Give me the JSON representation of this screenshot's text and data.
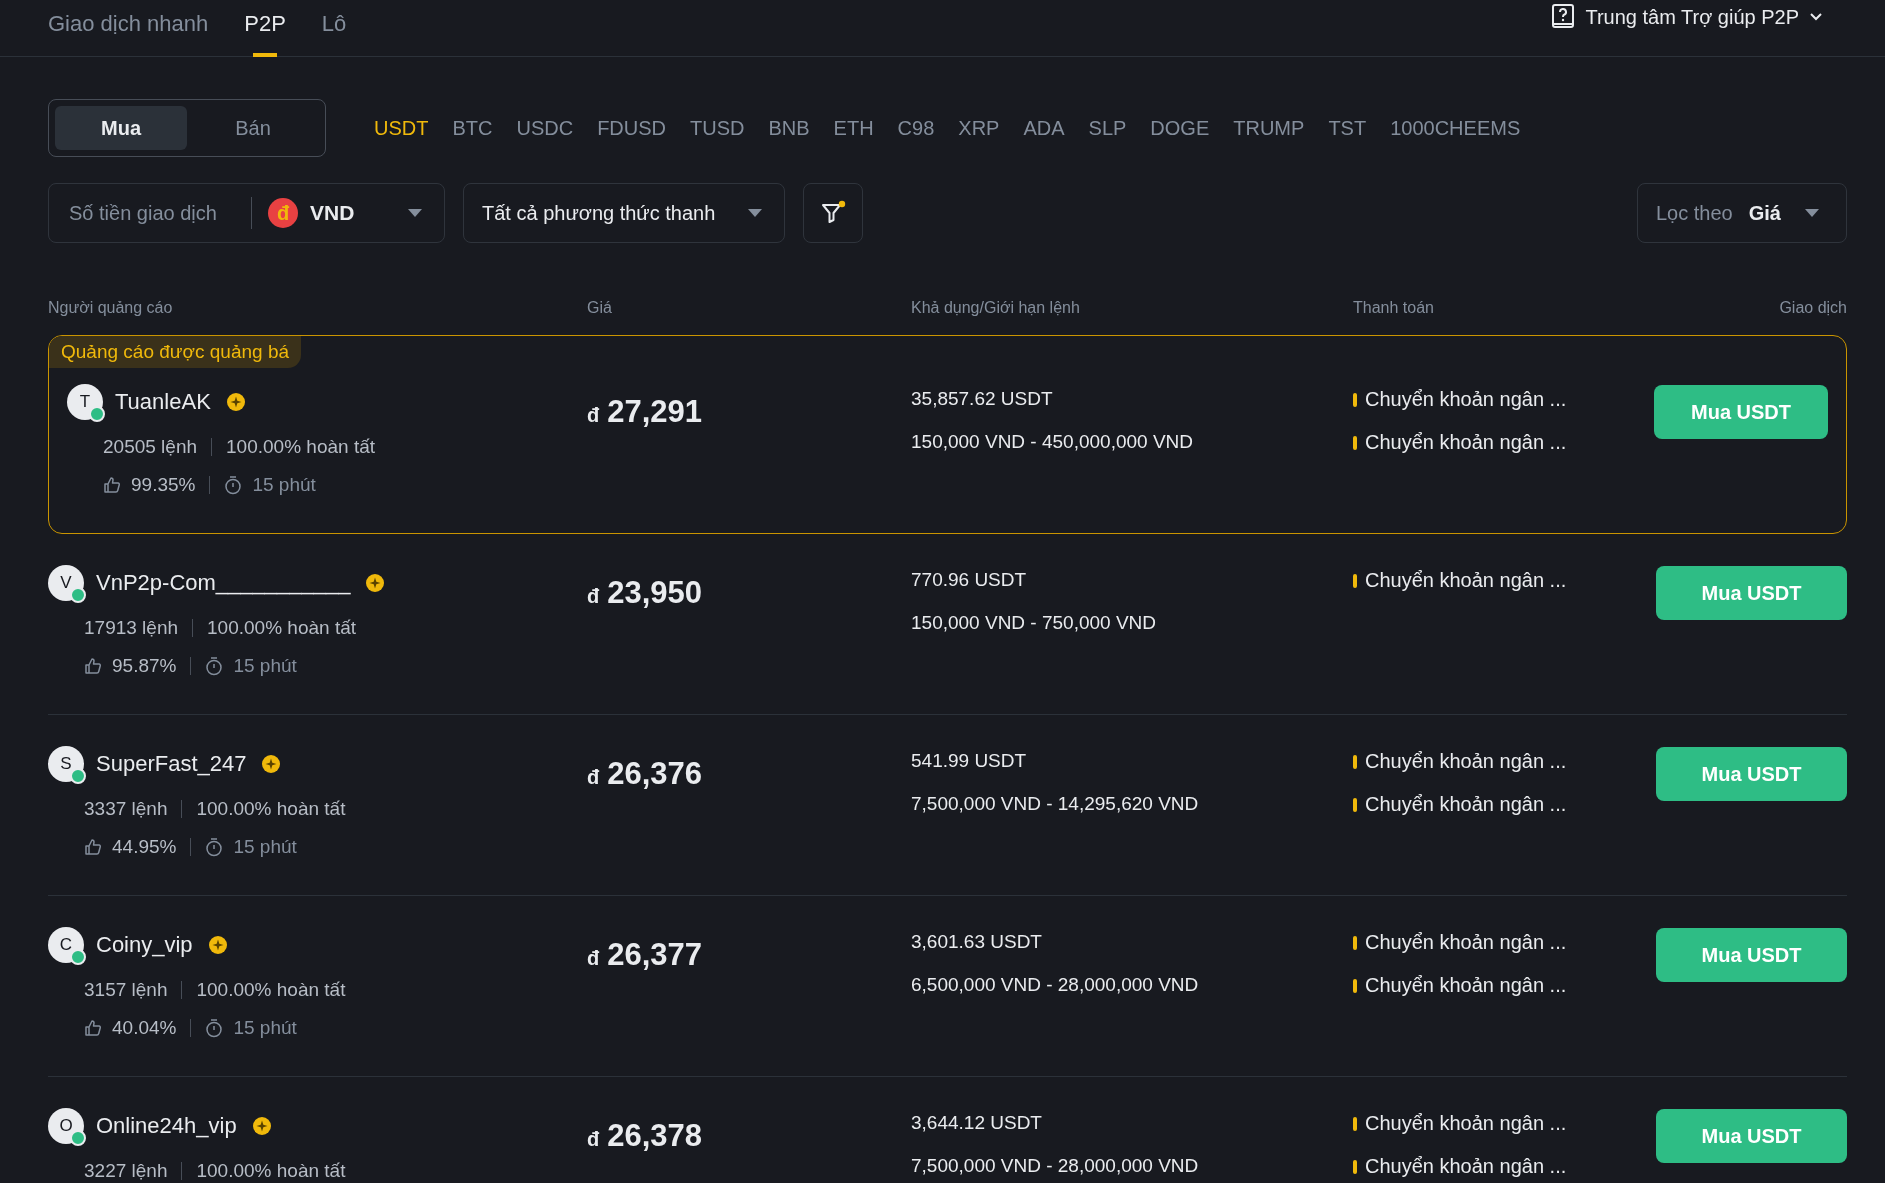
{
  "tabs": [
    {
      "label": "Giao dịch nhanh",
      "selected": false
    },
    {
      "label": "P2P",
      "selected": true
    },
    {
      "label": "Lô",
      "selected": false
    }
  ],
  "help": {
    "label": "Trung tâm Trợ giúp P2P"
  },
  "side_toggle": [
    {
      "label": "Mua",
      "selected": true
    },
    {
      "label": "Bán",
      "selected": false
    }
  ],
  "coins": [
    {
      "label": "USDT",
      "selected": true
    },
    {
      "label": "BTC",
      "selected": false
    },
    {
      "label": "USDC",
      "selected": false
    },
    {
      "label": "FDUSD",
      "selected": false
    },
    {
      "label": "TUSD",
      "selected": false
    },
    {
      "label": "BNB",
      "selected": false
    },
    {
      "label": "ETH",
      "selected": false
    },
    {
      "label": "C98",
      "selected": false
    },
    {
      "label": "XRP",
      "selected": false
    },
    {
      "label": "ADA",
      "selected": false
    },
    {
      "label": "SLP",
      "selected": false
    },
    {
      "label": "DOGE",
      "selected": false
    },
    {
      "label": "TRUMP",
      "selected": false
    },
    {
      "label": "TST",
      "selected": false
    },
    {
      "label": "1000CHEEMS",
      "selected": false
    }
  ],
  "amount_field": {
    "placeholder": "Số tiền giao dịch"
  },
  "currency": {
    "symbol": "đ",
    "code": "VND"
  },
  "payment_filter": {
    "value": "Tất cả phương thức thanh"
  },
  "filter_button": {
    "notified": true
  },
  "sort": {
    "label": "Lọc theo",
    "value": "Giá"
  },
  "columns": [
    "Người quảng cáo",
    "Giá",
    "Khả dụng/Giới hạn lệnh",
    "Thanh toán",
    "Giao dịch"
  ],
  "ads": [
    {
      "promoted": true,
      "promo_label": "Quảng cáo được quảng bá",
      "avatar": "T",
      "online": true,
      "name": "TuanleAK",
      "verified": true,
      "orders": "20505 lệnh",
      "completion": "100.00% hoàn tất",
      "rating": "99.35%",
      "time": "15 phút",
      "price_symbol": "đ",
      "price": "27,291",
      "available": "35,857.62 USDT",
      "limits": "150,000 VND - 450,000,000 VND",
      "payments": [
        "Chuyển khoản ngân ...",
        "Chuyển khoản ngân ..."
      ],
      "action": "Mua USDT"
    },
    {
      "promoted": false,
      "avatar": "V",
      "online": true,
      "name": "VnP2p-Com___________",
      "verified": true,
      "orders": "17913 lệnh",
      "completion": "100.00% hoàn tất",
      "rating": "95.87%",
      "time": "15 phút",
      "price_symbol": "đ",
      "price": "23,950",
      "available": "770.96 USDT",
      "limits": "150,000 VND - 750,000 VND",
      "payments": [
        "Chuyển khoản ngân ..."
      ],
      "action": "Mua USDT"
    },
    {
      "promoted": false,
      "avatar": "S",
      "online": true,
      "name": "SuperFast_247",
      "verified": true,
      "orders": "3337 lệnh",
      "completion": "100.00% hoàn tất",
      "rating": "44.95%",
      "time": "15 phút",
      "price_symbol": "đ",
      "price": "26,376",
      "available": "541.99 USDT",
      "limits": "7,500,000 VND - 14,295,620 VND",
      "payments": [
        "Chuyển khoản ngân ...",
        "Chuyển khoản ngân ..."
      ],
      "action": "Mua USDT"
    },
    {
      "promoted": false,
      "avatar": "C",
      "online": true,
      "name": "Coiny_vip",
      "verified": true,
      "orders": "3157 lệnh",
      "completion": "100.00% hoàn tất",
      "rating": "40.04%",
      "time": "15 phút",
      "price_symbol": "đ",
      "price": "26,377",
      "available": "3,601.63 USDT",
      "limits": "6,500,000 VND - 28,000,000 VND",
      "payments": [
        "Chuyển khoản ngân ...",
        "Chuyển khoản ngân ..."
      ],
      "action": "Mua USDT"
    },
    {
      "promoted": false,
      "avatar": "O",
      "online": true,
      "name": "Online24h_vip",
      "verified": true,
      "orders": "3227 lệnh",
      "completion": "100.00% hoàn tất",
      "price_symbol": "đ",
      "price": "26,378",
      "available": "3,644.12 USDT",
      "limits": "7,500,000 VND - 28,000,000 VND",
      "payments": [
        "Chuyển khoản ngân ...",
        "Chuyển khoản ngân ..."
      ],
      "action": "Mua USDT"
    }
  ]
}
